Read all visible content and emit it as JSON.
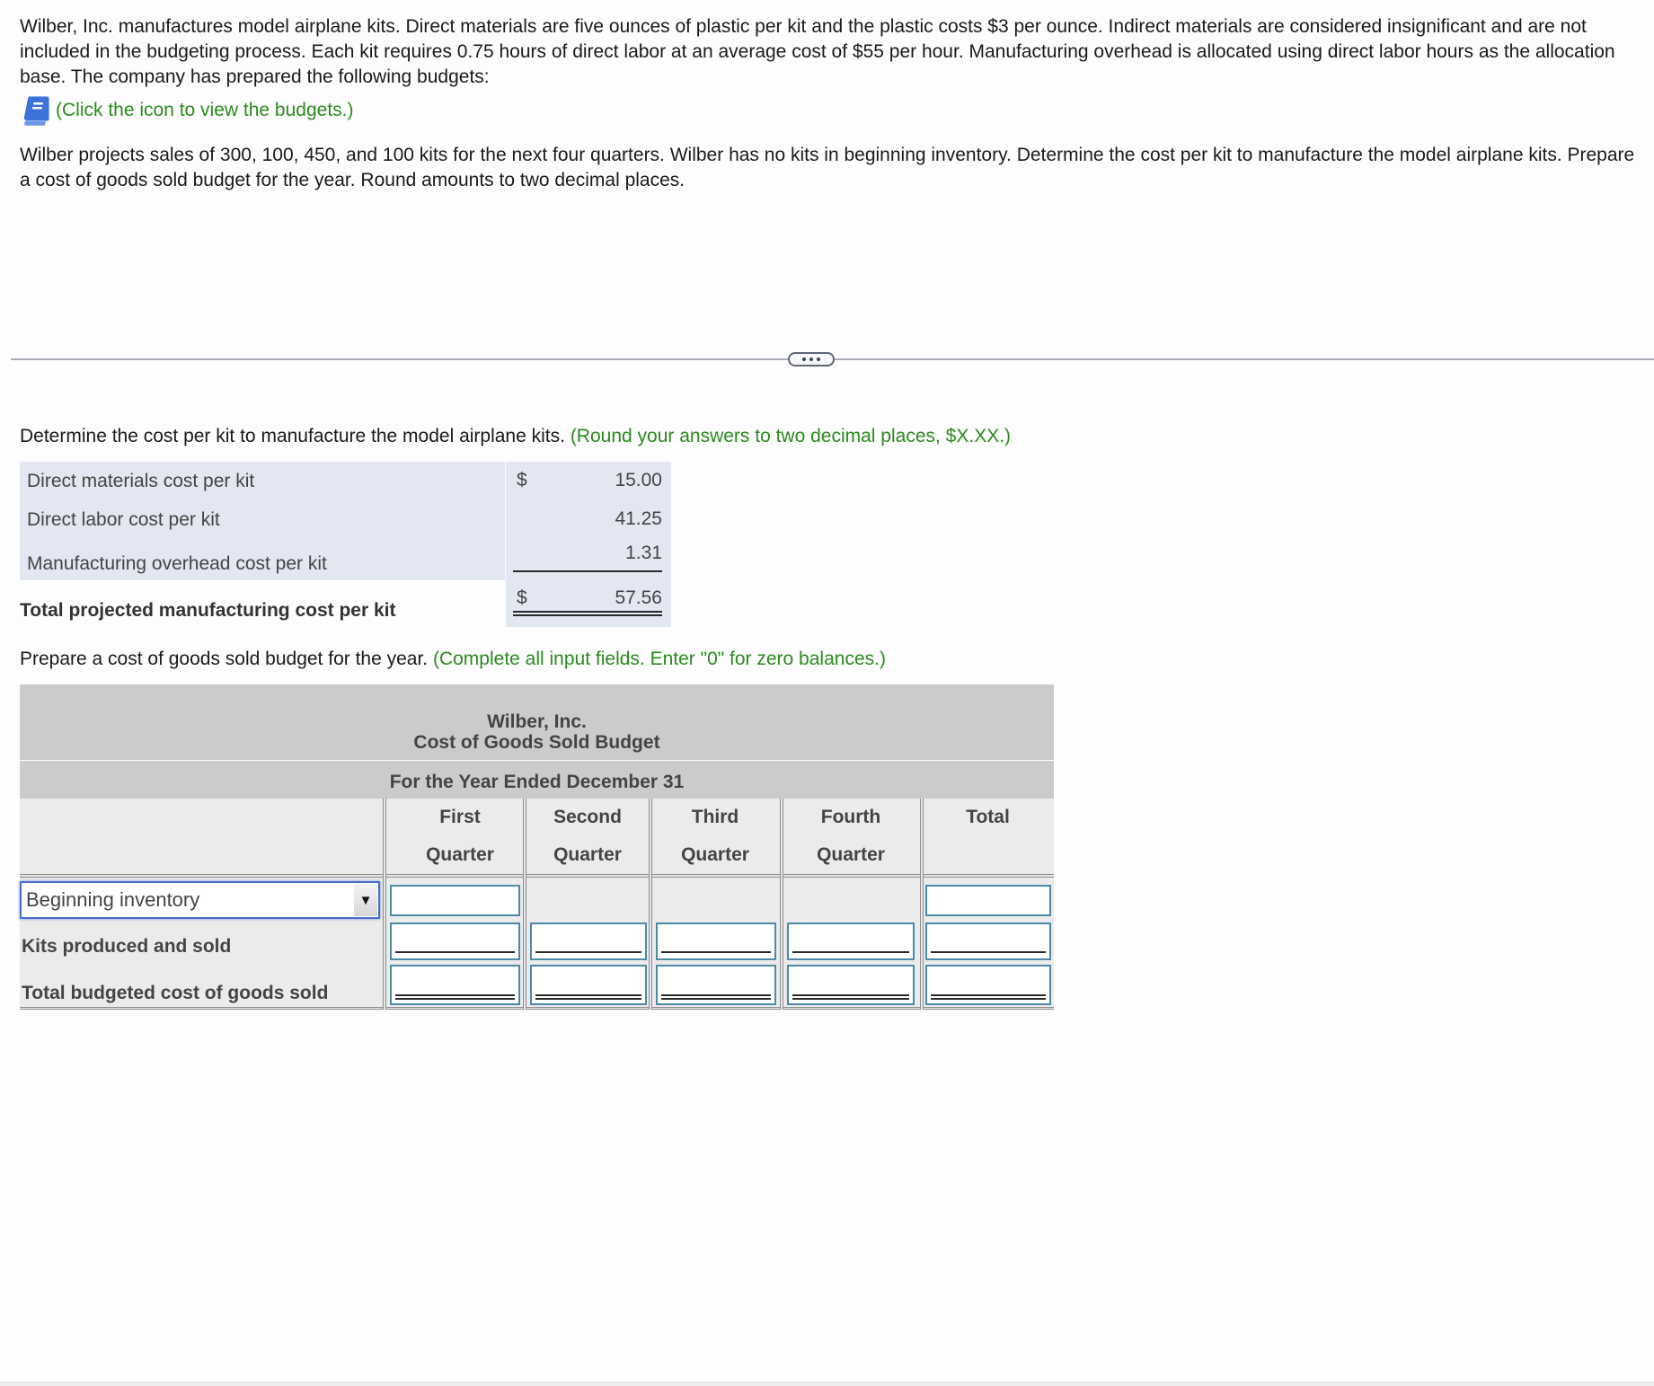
{
  "intro": {
    "paragraph1": "Wilber, Inc. manufactures model airplane kits. Direct materials are five ounces of plastic per kit and the plastic costs $3 per ounce. Indirect materials are considered insignificant and are not included in the budgeting process. Each kit requires 0.75 hours of direct labor at an average cost of $55 per hour. Manufacturing overhead is allocated using direct labor hours as the allocation base. The company has prepared the following budgets:",
    "budgets_link": "(Click the icon to view the budgets.)",
    "paragraph2": "Wilber projects sales of 300, 100, 450, and 100 kits for the next four quarters. Wilber has no kits in beginning inventory. Determine the cost per kit to manufacture the model airplane kits. Prepare a cost of goods sold budget for the year. Round amounts to two decimal places."
  },
  "divider": {
    "handle_label": "..."
  },
  "cost_section": {
    "instruction": "Determine the cost per kit to manufacture the model airplane kits.",
    "hint": "(Round your answers to two decimal places, $X.XX.)",
    "rows": [
      {
        "label": "Direct materials cost per kit",
        "currency": "$",
        "value": "15.00"
      },
      {
        "label": "Direct labor cost per kit",
        "currency": "",
        "value": "41.25"
      },
      {
        "label": "Manufacturing overhead cost per kit",
        "currency": "",
        "value": "1.31"
      }
    ],
    "total": {
      "label": "Total projected manufacturing cost per kit",
      "currency": "$",
      "value": "57.56"
    }
  },
  "cogs_section": {
    "instruction": "Prepare a cost of goods sold budget for the year.",
    "hint": "(Complete all input fields. Enter \"0\" for zero balances.)",
    "company": "Wilber, Inc.",
    "title": "Cost of Goods Sold Budget",
    "period": "For the Year Ended December 31",
    "columns": [
      {
        "line1": "First",
        "line2": "Quarter"
      },
      {
        "line1": "Second",
        "line2": "Quarter"
      },
      {
        "line1": "Third",
        "line2": "Quarter"
      },
      {
        "line1": "Fourth",
        "line2": "Quarter"
      },
      {
        "line1": "",
        "line2": "Total"
      }
    ],
    "rows": [
      {
        "label": "Beginning inventory",
        "type": "select",
        "values": [
          "",
          "",
          "",
          "",
          ""
        ]
      },
      {
        "label": "Kits produced and sold",
        "type": "text",
        "values": [
          "",
          "",
          "",
          "",
          ""
        ]
      },
      {
        "label": "Total budgeted cost of goods sold",
        "type": "text",
        "values": [
          "",
          "",
          "",
          "",
          ""
        ]
      }
    ]
  }
}
